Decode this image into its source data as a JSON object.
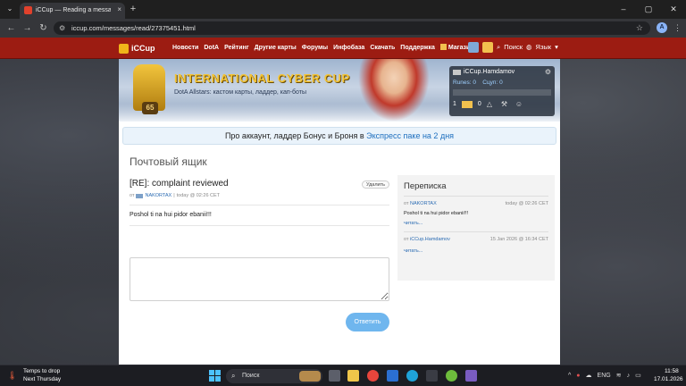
{
  "browser": {
    "tab_title": "iCCup — Reading a message fr",
    "tab_close": "×",
    "new_tab": "+",
    "url": "iccup.com/messages/read/27375451.html",
    "window_controls": [
      "–",
      "▢",
      "✕"
    ],
    "profile_initial": "A"
  },
  "site": {
    "logo": "iCCup",
    "nav": [
      "Новости",
      "DotA",
      "Рейтинг",
      "Другие карты",
      "Форумы",
      "Инфобаза",
      "Скачать",
      "Поддержка",
      "Магазин"
    ],
    "search_label": "Поиск",
    "language_label": "Язык"
  },
  "banner": {
    "title": "INTERNATIONAL CYBER CUP",
    "subtitle": "DotA Allstars: кастом карты, ладдер, кап-боты",
    "level": "65"
  },
  "user_panel": {
    "username": "iCCup.Hamdamov",
    "runes_label": "Runes: 0",
    "cups_label": "Сцуп: 0",
    "mail_count": "1",
    "alerts_count": "0"
  },
  "promo": {
    "text_before": "Про аккаунт, ладдер Бонус и Броня в ",
    "link_text": "Экспресс паке на 2 дня"
  },
  "page": {
    "heading": "Почтовый ящик"
  },
  "message": {
    "subject": "[RE]: complaint reviewed",
    "delete_label": "Удалить",
    "from_prefix": "от",
    "sender": "NAKORTAX",
    "divider": "|",
    "timestamp": "today @ 02:26 CET",
    "body": "Poshol ti na hui pidor ebanii!!!",
    "reply_label": "Ответить"
  },
  "conversation": {
    "title": "Переписка",
    "items": [
      {
        "from_prefix": "от",
        "sender": "NAKORTAX",
        "time": "today @ 02:26 CET",
        "text": "Poshol ti na hui pidor ebanii!!!",
        "read_label": "читать..."
      },
      {
        "from_prefix": "от",
        "sender": "iCCup.Hamdamov",
        "time": "15 Jan 2026 @ 16:34 CET",
        "text": "",
        "read_label": "читать..."
      }
    ]
  },
  "taskbar": {
    "weather_line1": "Temps to drop",
    "weather_line2": "Next Thursday",
    "search_placeholder": "Поиск",
    "language": "ENG",
    "time": "11:58",
    "date": "17.01.2026"
  }
}
